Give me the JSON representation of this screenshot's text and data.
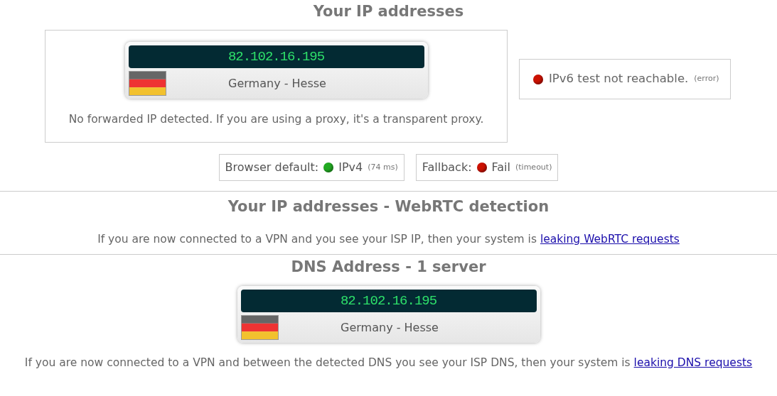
{
  "ip_section": {
    "title": "Your IP addresses",
    "card": {
      "ip": "82.102.16.195",
      "location": "Germany - Hesse"
    },
    "forwarded_note": "No forwarded IP detected. If you are using a proxy, it's a transparent proxy.",
    "ipv6": {
      "color": "#cc1100",
      "text": "IPv6 test not reachable.",
      "detail": "(error)"
    },
    "checks": [
      {
        "label": "Browser default:",
        "color": "#22aa22",
        "value": "IPv4",
        "detail": "(74 ms)"
      },
      {
        "label": "Fallback:",
        "color": "#cc1100",
        "value": "Fail",
        "detail": "(timeout)"
      }
    ]
  },
  "webrtc": {
    "title": "Your IP addresses - WebRTC detection",
    "note": "If you are now connected to a VPN and you see your ISP IP, then your system is ",
    "link": "leaking WebRTC requests"
  },
  "dns": {
    "title": "DNS Address - 1 server",
    "card": {
      "ip": "82.102.16.195",
      "location": "Germany - Hesse"
    },
    "note": "If you are now connected to a VPN and between the detected DNS you see your ISP DNS, then your system is ",
    "link": "leaking DNS requests"
  }
}
